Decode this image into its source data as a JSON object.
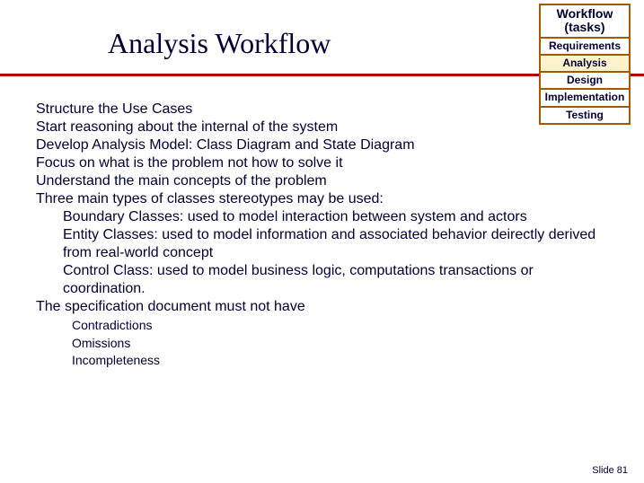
{
  "title": "Analysis Workflow",
  "workflow": {
    "header": "Workflow (tasks)",
    "items": [
      "Requirements",
      "Analysis",
      "Design",
      "Implementation",
      "Testing"
    ],
    "highlight_index": 1
  },
  "content": {
    "lines": [
      {
        "level": 1,
        "text": "Structure the Use Cases"
      },
      {
        "level": 1,
        "text": "Start reasoning about the internal of the system"
      },
      {
        "level": 1,
        "text": "Develop Analysis Model: Class Diagram and State Diagram"
      },
      {
        "level": 1,
        "text": "Focus on what is the problem not how to solve it"
      },
      {
        "level": 1,
        "text": "Understand the main concepts of the problem"
      },
      {
        "level": 1,
        "text": "Three main types of classes stereotypes may be used:"
      },
      {
        "level": 2,
        "text": " Boundary Classes: used to model interaction between system and actors"
      },
      {
        "level": 2,
        "text": " Entity Classes: used to model information and associated behavior deirectly derived from real-world concept"
      },
      {
        "level": 2,
        "text": "Control Class: used to model business logic, computations transactions or coordination."
      },
      {
        "level": 1,
        "text": "The specification document must not have"
      },
      {
        "level": 3,
        "text": "Contradictions"
      },
      {
        "level": 3,
        "text": "Omissions"
      },
      {
        "level": 3,
        "text": "Incompleteness"
      }
    ]
  },
  "slide_number": "Slide  81"
}
